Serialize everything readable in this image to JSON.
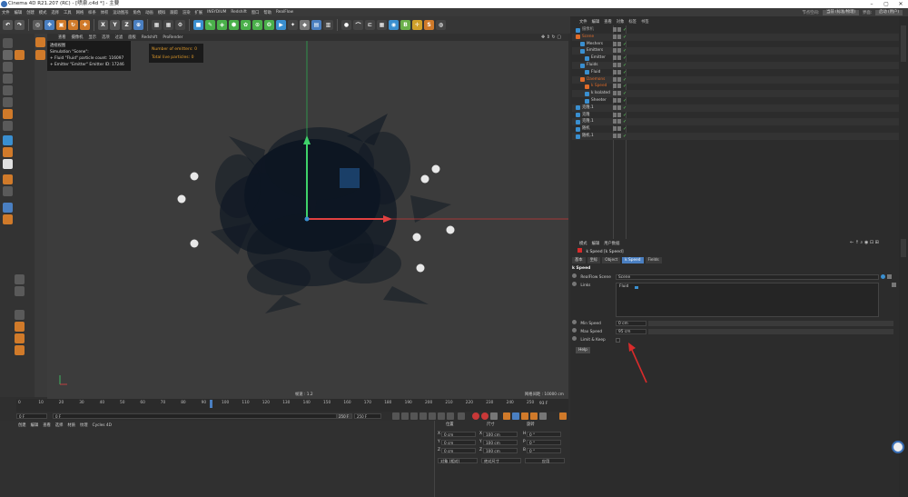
{
  "window": {
    "title": "Cinema 4D R21.207 (RC) - [喷泉.c4d *] - 主要",
    "min": "–",
    "max": "▢",
    "close": "✕"
  },
  "menubar": {
    "items": [
      "文件",
      "编辑",
      "创建",
      "模式",
      "选择",
      "工具",
      "网格",
      "样条",
      "体积",
      "运动图形",
      "角色",
      "动画",
      "模拟",
      "跟踪",
      "渲染",
      "扩展",
      "INSYDIUM",
      "Redshift",
      "窗口",
      "帮助",
      "RealFlow"
    ],
    "node_space_label": "节点空间:",
    "node_space_value": "当前 (标准/物理)",
    "layout_label": "界面:",
    "layout_value": "启动 (用户)"
  },
  "toolbar": {
    "x": "X",
    "y": "Y",
    "z": "Z",
    "b1": "B",
    "b2": "S"
  },
  "viewport": {
    "menu": [
      "查看",
      "摄像机",
      "显示",
      "选项",
      "过滤",
      "面板",
      "Redshift",
      "ProRender"
    ],
    "camera_label": "透视视图",
    "hud_lines": [
      "Simulation \"Scene\":",
      "+ Fluid \"Fluid\" particle count: 116097",
      "+ Emitter \"Emitter\" Emitter ID: 17246"
    ],
    "hud2_lines": [
      "Number of emitters: 0",
      "Total live particles: 0"
    ],
    "fps_label": "帧速 : 1.2",
    "grid_label": "网格间距 : 10000 cm"
  },
  "timeline": {
    "ticks": [
      "0",
      "10",
      "20",
      "30",
      "40",
      "50",
      "60",
      "70",
      "80",
      "90",
      "100",
      "110",
      "120",
      "130",
      "140",
      "150",
      "160",
      "170",
      "180",
      "190",
      "200",
      "210",
      "220",
      "230",
      "240",
      "250"
    ],
    "current_frame": "93 F",
    "start": "0 F",
    "start2": "0 F",
    "end": "250 F",
    "end2": "250 F"
  },
  "bottom": {
    "menu": [
      "创建",
      "编辑",
      "查看",
      "选择",
      "材质",
      "纹理",
      "Cycles 4D"
    ],
    "position_header": "位置",
    "size_header": "尺寸",
    "rotation_header": "旋转",
    "rows": [
      {
        "axis": "X",
        "pos": "0 cm",
        "saxis": "X",
        "size": "100 cm",
        "raxis": "H",
        "rot": "0 °"
      },
      {
        "axis": "Y",
        "pos": "0 cm",
        "saxis": "Y",
        "size": "100 cm",
        "raxis": "P",
        "rot": "0 °"
      },
      {
        "axis": "Z",
        "pos": "0 cm",
        "saxis": "Z",
        "size": "100 cm",
        "raxis": "B",
        "rot": "0 °"
      }
    ],
    "object_mode": "对象 (相对)",
    "size_mode": "绝对尺寸",
    "apply": "应用"
  },
  "objects": {
    "menu": [
      "文件",
      "编辑",
      "查看",
      "对象",
      "标签",
      "书签"
    ],
    "rows": [
      {
        "name": "摄像机",
        "indent": 0,
        "color": "#999999"
      },
      {
        "name": "Scene",
        "indent": 0,
        "color": "#e06c2a"
      },
      {
        "name": "Meshers",
        "indent": 1,
        "color": "#d0d0d0"
      },
      {
        "name": "Emitters",
        "indent": 1,
        "color": "#d0d0d0"
      },
      {
        "name": "Emitter",
        "indent": 2,
        "color": "#d0d0d0"
      },
      {
        "name": "Fluids",
        "indent": 1,
        "color": "#d0d0d0"
      },
      {
        "name": "Fluid",
        "indent": 2,
        "color": "#d0d0d0"
      },
      {
        "name": "Daemons",
        "indent": 1,
        "color": "#e06c2a"
      },
      {
        "name": "k Speed",
        "indent": 2,
        "color": "#e06c2a"
      },
      {
        "name": "k Isolated",
        "indent": 2,
        "color": "#d0d0d0"
      },
      {
        "name": "Sheeter",
        "indent": 2,
        "color": "#d0d0d0"
      },
      {
        "name": "克隆.1",
        "indent": 0,
        "color": "#d0d0d0"
      },
      {
        "name": "克隆",
        "indent": 0,
        "color": "#d0d0d0"
      },
      {
        "name": "克隆.1",
        "indent": 0,
        "color": "#d0d0d0"
      },
      {
        "name": "随机",
        "indent": 0,
        "color": "#d0d0d0"
      },
      {
        "name": "随机.1",
        "indent": 0,
        "color": "#d0d0d0"
      }
    ]
  },
  "attributes": {
    "menu": [
      "模式",
      "编辑",
      "用户数据"
    ],
    "header": "k Speed [k Speed]",
    "tabs": [
      "基本",
      "坐标",
      "Object",
      "k Speed",
      "Fields"
    ],
    "active_tab": "k Speed",
    "section": "k Speed",
    "realflow_scene_label": "RealFlow Scene",
    "realflow_scene_value": "Scene",
    "links_label": "Links",
    "links_value": "Fluid",
    "min_speed_label": "Min Speed",
    "min_speed_value": "0 cm",
    "max_speed_label": "Max Speed",
    "max_speed_value": "95 cm",
    "limit_keep_label": "Limit & Keep",
    "help_label": "Help"
  },
  "colors": {
    "accent": "#4a7fc1",
    "arrow": "#d92b2b",
    "orange": "#e06c2a"
  }
}
